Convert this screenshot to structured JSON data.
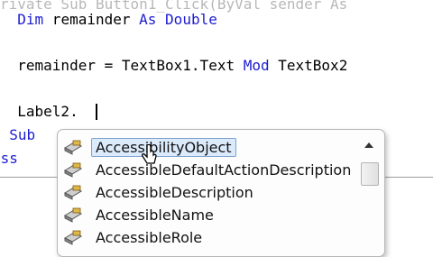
{
  "code": {
    "line_top": "rivate Sub Button1_Click(ByVal sender As",
    "line_dim": "  Dim remainder As Double",
    "line_dim_parts": {
      "indent": "  ",
      "kw1": "Dim",
      "name": " remainder ",
      "kw2": "As",
      "sp": " ",
      "kw3": "Double"
    },
    "line_assign_parts": {
      "indent": "  ",
      "left": "remainder = TextBox1.Text ",
      "kw": "Mod",
      "right": " TextBox2"
    },
    "line_label": "  Label2.",
    "line_endsub_parts": {
      "kw1": "d Sub"
    },
    "line_class_parts": {
      "kw1": "ass"
    }
  },
  "intellisense": {
    "items": [
      {
        "label": "AccessibilityObject",
        "icon": "property-icon",
        "selected": true
      },
      {
        "label": "AccessibleDefaultActionDescription",
        "icon": "property-icon",
        "selected": false
      },
      {
        "label": "AccessibleDescription",
        "icon": "property-icon",
        "selected": false
      },
      {
        "label": "AccessibleName",
        "icon": "property-icon",
        "selected": false
      },
      {
        "label": "AccessibleRole",
        "icon": "property-icon",
        "selected": false
      }
    ]
  },
  "colors": {
    "keyword": "#1c1cd0",
    "selection": "#dcebfc",
    "selection_border": "#7da2ce"
  }
}
